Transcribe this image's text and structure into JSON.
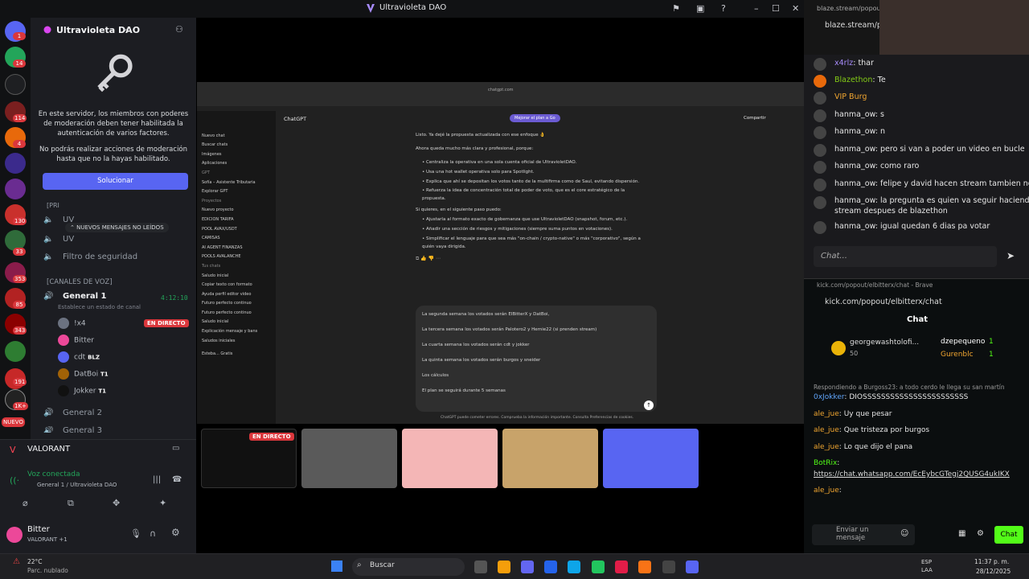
{
  "window": {
    "title": "Ultravioleta DAO"
  },
  "server": {
    "name": "Ultravioleta DAO",
    "mod_notice_1": "En este servidor, los miembros con poderes de moderación deben tener habilitada la autenticación de varios factores.",
    "mod_notice_2": "No podrás realizar acciones de moderación hasta que no la hayas habilitado.",
    "solve_button": "Solucionar",
    "new_unread": "NUEVOS MENSAJES NO LEÍDOS",
    "section_partial": "[PRI",
    "channels": [
      {
        "label": "UV"
      },
      {
        "label": "UV"
      },
      {
        "label": "Filtro de seguridad"
      }
    ],
    "voice_header": "[CANALES DE VOZ]",
    "voice_channel": {
      "name": "General 1",
      "timer": "4:12:10",
      "status_prompt": "Establece un estado de canal"
    },
    "live_badge": "EN DIRECTO",
    "voice_users": [
      {
        "name": "!x4",
        "tag": ""
      },
      {
        "name": "Bitter",
        "tag": ""
      },
      {
        "name": "cdt",
        "tag": "BLZ"
      },
      {
        "name": "DatBoi",
        "tag": "T1"
      },
      {
        "name": "Jokker",
        "tag": "T1"
      }
    ],
    "more_channels": [
      "General 2",
      "General 3"
    ],
    "server_badges": [
      "1",
      "14",
      "114",
      "4",
      "130",
      "33",
      "353",
      "85",
      "343",
      "191",
      "1K+",
      "NUEVO"
    ]
  },
  "voice_panel": {
    "game": "VALORANT",
    "connected": "Voz conectada",
    "location": "General 1 / Ultravioleta DAO",
    "user": "Bitter",
    "user_status": "VALORANT +1"
  },
  "share": {
    "tab_url": "chatgpt.com",
    "model": "ChatGPT",
    "upgrade": "Mejorar el plan a Go",
    "share": "Compartir",
    "sidebar": [
      "Nuevo chat",
      "Buscar chats",
      "Imágenes",
      "Aplicaciones",
      "GPT",
      "Sofía – Asistente Tributaria",
      "Explorar GPT",
      "Proyectos",
      "Nuevo proyecto",
      "EDICION TARIFA",
      "POOL AVAX/USDT",
      "CAMISAS",
      "AI AGENT FINANZAS",
      "POOLS AVALANCHE",
      "Tus chats",
      "Saludo inicial",
      "Copiar texto con formato",
      "Ayuda perfil editor video",
      "Futuro perfecto continuo",
      "Futuro perfecto continuo",
      "Saludo inicial",
      "Explicación mensaje y bans",
      "Saludos iniciales"
    ],
    "user": "Esteba... Gratis",
    "upgrade_small": "Mejorar el plan",
    "lines": [
      "Listo. Ya dejé la propuesta actualizada con ese enfoque 👌",
      "Ahora queda mucho más clara y profesional, porque:",
      "• Centraliza la operativa en una sola cuenta oficial de UltravioletDAO.",
      "• Usa una hot wallet operativa solo para Spotlight.",
      "• Explica que ahí se depositan los votos tanto de la multifirma como de Saul, evitando dispersión.",
      "• Refuerza la idea de concentración total de poder de voto, que es el core estratégico de la",
      "  propuesta.",
      "Si quieres, en el siguiente paso puedo:",
      "• Ajustarla al formato exacto de gobernanza que use UltravioletDAO (snapshot, forum, etc.).",
      "• Añadir una sección de riesgos y mitigaciones (siempre suma puntos en votaciones).",
      "• Simplificar el lenguaje para que sea más \"on-chain / crypto-native\" o más \"corporativo\", según a",
      "  quién vaya dirigida."
    ],
    "input_lines": [
      "La segunda semana los votados serán ElBitterX y DatBoi,",
      "La tercera semana los votados serán Palotero2 y Hernie22 (si prenden stream)",
      "La cuarta semana los votados serán cdt y jokker",
      "La quinta semana los votados serán burgos y sneider",
      "Los cálculos",
      "El plan se seguirá durante 5 semanas"
    ],
    "disclaimer": "ChatGPT puede cometer errores. Comprueba la información importante. Consulta Preferencias de cookies."
  },
  "tiles": [
    {
      "live": "EN DIRECTO"
    }
  ],
  "blaze": {
    "url_partial": "blaze.stream/popout/",
    "url": "blaze.stream/pop",
    "messages": [
      {
        "user": "x4rlz",
        "text": "thar"
      },
      {
        "user": "Blazethon",
        "text": "Te"
      },
      {
        "user": "VIP Burg",
        "text": ""
      },
      {
        "user": "hanma_ow",
        "text": "s"
      },
      {
        "user": "hanma_ow",
        "text": "n"
      },
      {
        "user": "hanma_ow",
        "text": "pero si van a poder un video en bucle"
      },
      {
        "user": "hanma_ow",
        "text": "como raro"
      },
      {
        "user": "hanma_ow",
        "text": "felipe y david hacen stream tambien no?"
      },
      {
        "user": "hanma_ow",
        "text": "la pregunta es quien va seguir haciendo"
      },
      {
        "user": "",
        "text": "stream despues de blazethon"
      },
      {
        "user": "hanma_ow",
        "text": "igual quedan 6 dias pa votar"
      }
    ],
    "placeholder": "Chat..."
  },
  "kick": {
    "window_title": "kick.com/popout/elbitterx/chat - Brave",
    "url": "kick.com/popout/elbitterx/chat",
    "header": "Chat",
    "gifter": "georgewashtolofi...",
    "gifter_count": "50",
    "gifts": [
      {
        "user": "dzepequeno",
        "count": "1"
      },
      {
        "user": "Gurenblc",
        "count": "1"
      }
    ],
    "reply_note": "Respondiendo a Burgoss23: a todo cerdo le llega su san martín",
    "messages": [
      {
        "user": "0xJokker",
        "text": "DIOSSSSSSSSSSSSSSSSSSSSSSS"
      },
      {
        "user": "ale_jue",
        "text": "Uy que pesar"
      },
      {
        "user": "ale_jue",
        "text": "Que tristeza por burgos"
      },
      {
        "user": "ale_jue",
        "text": "Lo que dijo el pana"
      },
      {
        "user": "BotRix",
        "text": ""
      },
      {
        "user": "",
        "text": "https://chat.whatsapp.com/EcEybcGTegj2QUSG4ukIKX"
      },
      {
        "user": "ale_jue",
        "text": ""
      }
    ],
    "placeholder": "Enviar un mensaje",
    "send": "Chat"
  },
  "taskbar": {
    "weather_temp": "22°C",
    "weather_desc": "Parc. nublado",
    "search": "Buscar",
    "lang": "ESP",
    "lang2": "LAA",
    "time": "11:37 p. m.",
    "date": "28/12/2025"
  },
  "colors": {
    "discord_blurple": "#5865f2",
    "live_red": "#da373c",
    "kick_green": "#53fc18"
  }
}
